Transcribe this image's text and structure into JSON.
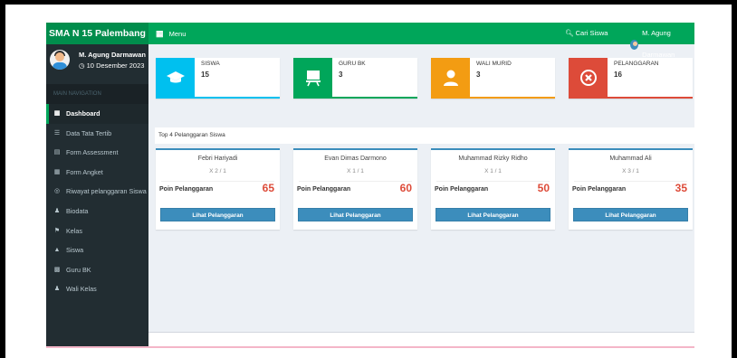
{
  "brand": "SMA N 15 Palembang",
  "topbar": {
    "menu_label": "Menu",
    "search_label": "Cari Siswa",
    "user_label": "M. Agung Darmawan"
  },
  "user_panel": {
    "name": "M. Agung Darmawan",
    "date": "10 Desember 2023"
  },
  "sidebar": {
    "header": "MAIN NAVIGATION",
    "items": [
      {
        "label": "Dashboard",
        "icon": "grid-icon"
      },
      {
        "label": "Data Tata Tertib",
        "icon": "list-icon"
      },
      {
        "label": "Form Assessment",
        "icon": "table-icon"
      },
      {
        "label": "Form Angket",
        "icon": "form-icon"
      },
      {
        "label": "Riwayat pelanggaran Siswa",
        "icon": "target-icon"
      },
      {
        "label": "Biodata",
        "icon": "user-icon"
      },
      {
        "label": "Kelas",
        "icon": "tag-icon"
      },
      {
        "label": "Siswa",
        "icon": "graduation-cap-icon"
      },
      {
        "label": "Guru BK",
        "icon": "board-icon"
      },
      {
        "label": "Wali Kelas",
        "icon": "user-icon"
      }
    ]
  },
  "stats": [
    {
      "label": "SISWA",
      "value": "15",
      "color": "#00c0ef",
      "icon": "graduation-cap-icon"
    },
    {
      "label": "GURU BK",
      "value": "3",
      "color": "#00a65a",
      "icon": "board-icon"
    },
    {
      "label": "WALI MURID",
      "value": "3",
      "color": "#f39c12",
      "icon": "user-icon"
    },
    {
      "label": "PELANGGARAN",
      "value": "16",
      "color": "#dd4b39",
      "icon": "times-circle-icon"
    }
  ],
  "top_section_title": "Top 4 Pelanggaran Siswa",
  "top_students": [
    {
      "name": "Febri Hariyadi",
      "class": "X 2 / 1",
      "poin_label": "Poin Pelanggaran",
      "poin": "65",
      "button": "Lihat Pelanggaran"
    },
    {
      "name": "Evan Dimas Darmono",
      "class": "X 1 / 1",
      "poin_label": "Poin Pelanggaran",
      "poin": "60",
      "button": "Lihat Pelanggaran"
    },
    {
      "name": "Muhammad Rizky Ridho",
      "class": "X 1 / 1",
      "poin_label": "Poin Pelanggaran",
      "poin": "50",
      "button": "Lihat Pelanggaran"
    },
    {
      "name": "Muhammad Ali",
      "class": "X 3 / 1",
      "poin_label": "Poin Pelanggaran",
      "poin": "35",
      "button": "Lihat Pelanggaran"
    }
  ]
}
